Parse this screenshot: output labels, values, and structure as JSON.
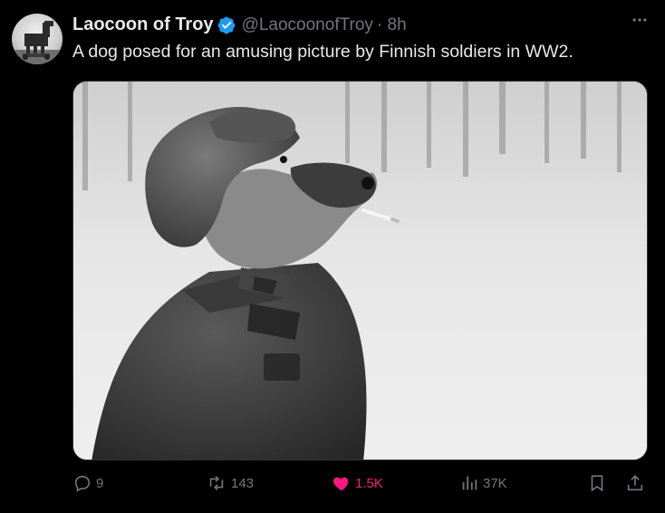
{
  "post": {
    "author": {
      "display_name": "Laocoon of Troy",
      "handle": "@LaocoonofTroy",
      "time": "· 8h",
      "verified": true
    },
    "text": "A dog posed for an amusing picture by Finnish soldiers in WW2.",
    "media": {
      "kind": "black-and-white photo",
      "subject": "dog in fur hat and military greatcoat with a cigarette"
    },
    "actions": {
      "replies": "9",
      "reposts": "143",
      "likes": "1.5K",
      "views": "37K"
    }
  },
  "icons": [
    "more-icon",
    "verified-icon",
    "reply-icon",
    "repost-icon",
    "like-icon",
    "views-icon",
    "bookmark-icon",
    "share-icon"
  ],
  "colors": {
    "background": "#000000",
    "text": "#e7e9ea",
    "muted": "#71767b",
    "verified": "#1d9bf0",
    "like": "#f91880"
  }
}
